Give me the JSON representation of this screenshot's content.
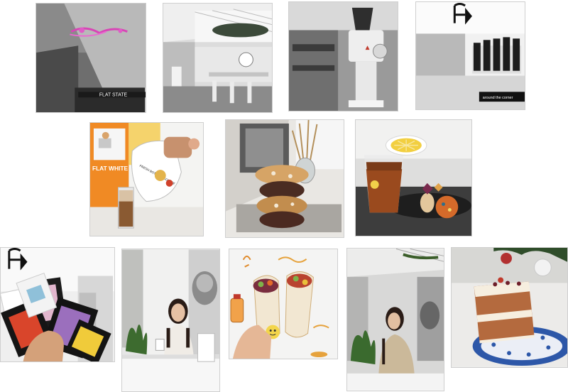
{
  "gallery": {
    "row1": [
      {
        "id": "interior-neon",
        "sign": "FLAT STATE"
      },
      {
        "id": "interior-bright-room",
        "sign": ""
      },
      {
        "id": "grinder-bar",
        "sign": ""
      },
      {
        "id": "counter-cups",
        "sign": "around the corner"
      }
    ],
    "row2": [
      {
        "id": "flat-white-bag",
        "poster": "FLAT WHITE",
        "bag": "FRESH BOTTLED COFFEE"
      },
      {
        "id": "cookie-stack",
        "sign": ""
      },
      {
        "id": "iced-tea-cookies",
        "sign": ""
      }
    ],
    "row3": [
      {
        "id": "coffee-drip-bags",
        "sign": ""
      },
      {
        "id": "woman-white-shirt",
        "sign": ""
      },
      {
        "id": "wraps",
        "sign": ""
      },
      {
        "id": "woman-beige-jacket",
        "sign": ""
      },
      {
        "id": "carrot-cake",
        "sign": ""
      }
    ]
  }
}
